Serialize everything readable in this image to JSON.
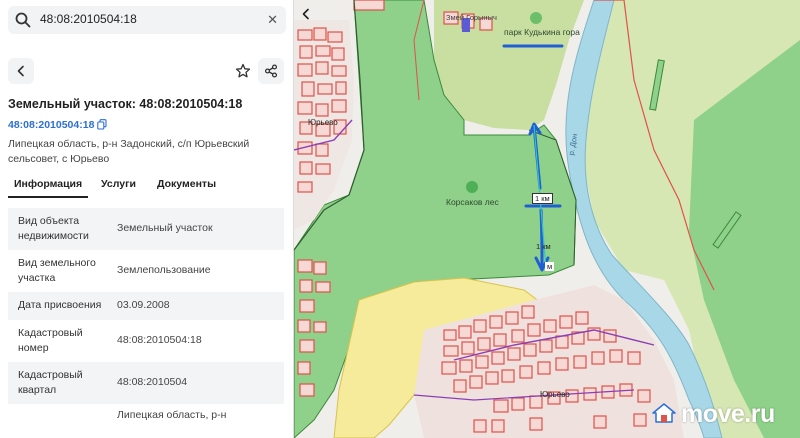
{
  "search": {
    "value": "48:08:2010504:18"
  },
  "plot": {
    "title": "Земельный участок: 48:08:2010504:18",
    "cad_link": "48:08:2010504:18",
    "address": "Липецкая область, р-н Задонский, с/п Юрьевский сельсовет, с Юрьево"
  },
  "tabs": [
    {
      "label": "Информация",
      "active": true
    },
    {
      "label": "Услуги",
      "active": false
    },
    {
      "label": "Документы",
      "active": false
    }
  ],
  "properties": [
    {
      "key": "Вид объекта недвижимости",
      "value": "Земельный участок"
    },
    {
      "key": "Вид земельного участка",
      "value": "Землепользование"
    },
    {
      "key": "Дата присвоения",
      "value": "03.09.2008"
    },
    {
      "key": "Кадастровый номер",
      "value": "48:08:2010504:18"
    },
    {
      "key": "Кадастровый квартал",
      "value": "48:08:2010504"
    },
    {
      "key": "",
      "value": "Липецкая область, р-н"
    }
  ],
  "map": {
    "labels": {
      "park": "парк Кудькина гора",
      "zmei": "Змей Горыныч",
      "forest": "Корсаков лес",
      "village": "Юрьево",
      "north": "Юрьево",
      "river": "р. Дон",
      "km1": "1 км",
      "km2": "1 км",
      "m": "м"
    },
    "colors": {
      "forest": "#8fd18a",
      "light_green": "#d6e7b3",
      "yellow": "#f6eb9b",
      "river": "#a8d8e8",
      "parcel_line": "#e0524a",
      "annotation": "#1f5fd6"
    }
  },
  "brand": {
    "logo": "move.ru"
  },
  "icons": [
    "search-icon",
    "close-icon",
    "back-arrow-icon",
    "star-icon",
    "share-icon",
    "copy-icon",
    "tree-icon"
  ]
}
